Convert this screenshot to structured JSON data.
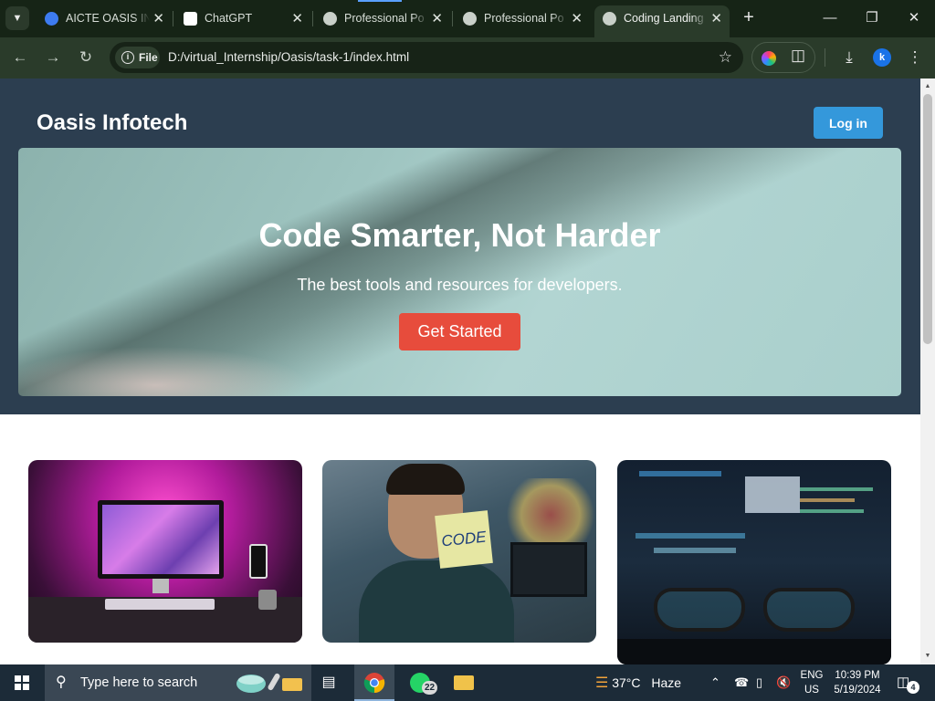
{
  "browser": {
    "tabs": [
      {
        "title": "AICTE OASIS IN",
        "icon": "aicte-favicon",
        "active": false
      },
      {
        "title": "ChatGPT",
        "icon": "chatgpt-favicon",
        "active": false
      },
      {
        "title": "Professional Po",
        "icon": "globe-icon",
        "active": false
      },
      {
        "title": "Professional Po",
        "icon": "globe-icon",
        "active": false
      },
      {
        "title": "Coding Landing",
        "icon": "globe-icon",
        "active": true
      }
    ],
    "new_tab": "+",
    "address": {
      "scheme_chip": "File",
      "url": "D:/virtual_Internship/Oasis/task-1/index.html"
    },
    "profile_initial": "k"
  },
  "page": {
    "brand": "Oasis Infotech",
    "login_label": "Log in",
    "hero": {
      "title": "Code Smarter, Not Harder",
      "subtitle": "The best tools and resources for developers.",
      "cta_label": "Get Started"
    },
    "cards": [
      {
        "subject": "desk-setup-magenta-lighting"
      },
      {
        "subject": "man-holding-code-note",
        "note_text": "CODE"
      },
      {
        "subject": "glasses-in-front-of-code-monitor"
      }
    ],
    "colors": {
      "header_bg": "#2c3e50",
      "login_bg": "#3498db",
      "cta_bg": "#e74c3c"
    }
  },
  "taskbar": {
    "search_placeholder": "Type here to search",
    "whatsapp_badge": "22",
    "weather_temp": "37°C",
    "weather_desc": "Haze",
    "lang_top": "ENG",
    "lang_bottom": "US",
    "time": "10:39 PM",
    "date": "5/19/2024",
    "notification_count": "4"
  }
}
